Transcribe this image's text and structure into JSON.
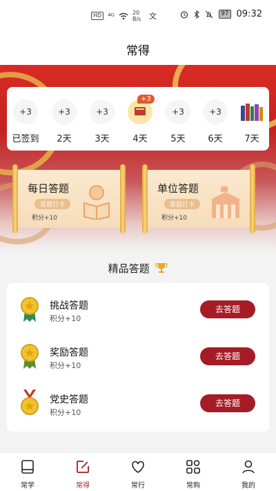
{
  "status_bar": {
    "network_badge": "HD",
    "signal": "⁴ᴳ",
    "speed": "20 B/s",
    "ime": "文",
    "battery": "97",
    "time": "09:32"
  },
  "header": {
    "title": "常得"
  },
  "sign_in": {
    "bonus_tag": "+3",
    "days": [
      {
        "value": "+3",
        "label": "已签到"
      },
      {
        "value": "+3",
        "label": "2天"
      },
      {
        "value": "+3",
        "label": "3天"
      },
      {
        "value": "",
        "label": "4天",
        "icon": "book-icon"
      },
      {
        "value": "+3",
        "label": "5天"
      },
      {
        "value": "+3",
        "label": "6天"
      },
      {
        "value": "",
        "label": "7天",
        "icon": "books-icon"
      }
    ]
  },
  "quiz_cards": [
    {
      "title": "每日答题",
      "chip": "答题打卡",
      "points": "积分+10",
      "icon": "reading-person-icon"
    },
    {
      "title": "单位答题",
      "chip": "答题打卡",
      "points": "积分+10",
      "icon": "building-icon"
    }
  ],
  "premium": {
    "title": "精品答题",
    "items": [
      {
        "name": "挑战答题",
        "points": "积分+10",
        "button": "去答题",
        "medal_color": "#2e8b57"
      },
      {
        "name": "奖励答题",
        "points": "积分+10",
        "button": "去答题",
        "medal_color": "#5a8f2b"
      },
      {
        "name": "党史答题",
        "points": "积分+10",
        "button": "去答题",
        "medal_color": "#c0392b"
      }
    ]
  },
  "tabs": [
    {
      "label": "常学",
      "icon": "book-icon"
    },
    {
      "label": "常得",
      "icon": "edit-icon",
      "active": true
    },
    {
      "label": "常行",
      "icon": "heart-icon"
    },
    {
      "label": "常购",
      "icon": "grid-icon"
    },
    {
      "label": "我的",
      "icon": "user-icon"
    }
  ],
  "colors": {
    "brand": "#a61c26",
    "hero_red": "#d92b24",
    "gold": "#e8a53c"
  }
}
